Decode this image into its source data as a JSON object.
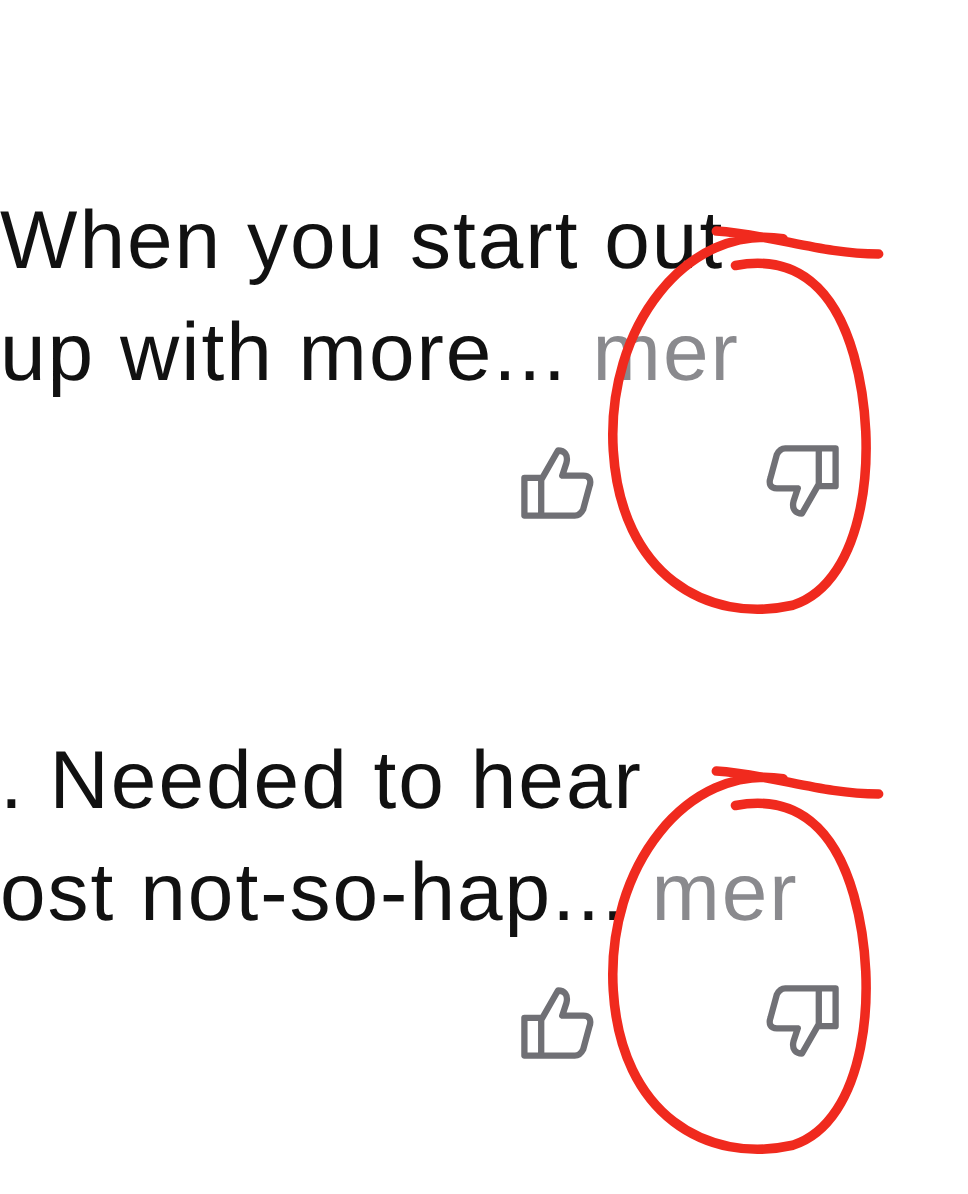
{
  "reviews": [
    {
      "lines": [
        "When you start out",
        "up with more..."
      ],
      "more": "mer",
      "circled": true
    },
    {
      "lines": [
        ". Needed to hear",
        "ost not-so-hap..."
      ],
      "more": "mer",
      "circled": true
    }
  ]
}
